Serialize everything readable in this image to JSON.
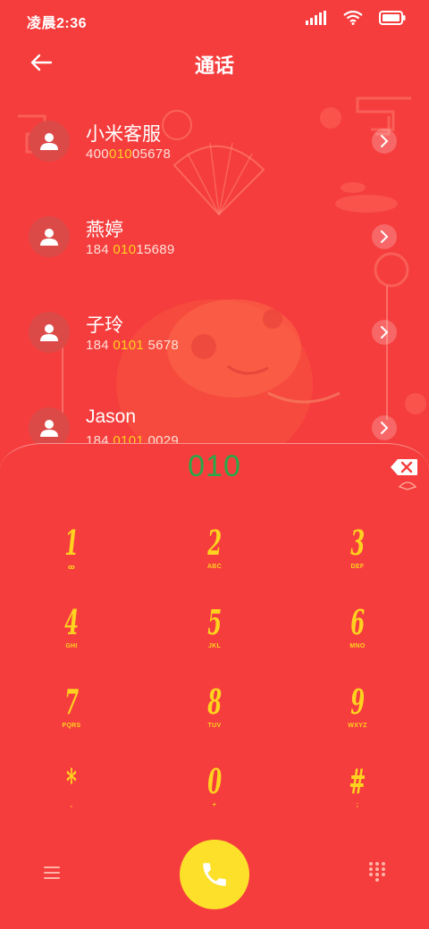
{
  "status_bar": {
    "time": "凌晨2:36",
    "icons": [
      "signal-icon",
      "wifi-icon",
      "battery-icon"
    ]
  },
  "header": {
    "title": "通话",
    "back_icon": "arrow-left-icon"
  },
  "contacts": [
    {
      "name": "小米客服",
      "number_pre": "400",
      "number_hl": "010",
      "number_post": "05678"
    },
    {
      "name": "燕婷",
      "number_pre": "184 ",
      "number_hl": "010",
      "number_post": "15689"
    },
    {
      "name": "子玲",
      "number_pre": "184 ",
      "number_hl": "0101",
      "number_post": " 5678"
    },
    {
      "name": "Jason",
      "number_pre": "184 ",
      "number_hl": "0101",
      "number_post": " 0029"
    }
  ],
  "dialpad": {
    "dialed": "010",
    "keys": [
      {
        "digit": "1",
        "letters": "ꝏ"
      },
      {
        "digit": "2",
        "letters": "ABC"
      },
      {
        "digit": "3",
        "letters": "DEF"
      },
      {
        "digit": "4",
        "letters": "GHI"
      },
      {
        "digit": "5",
        "letters": "JKL"
      },
      {
        "digit": "6",
        "letters": "MNO"
      },
      {
        "digit": "7",
        "letters": "PQRS"
      },
      {
        "digit": "8",
        "letters": "TUV"
      },
      {
        "digit": "9",
        "letters": "WXYZ"
      },
      {
        "digit": "*",
        "letters": ","
      },
      {
        "digit": "0",
        "letters": "+"
      },
      {
        "digit": "#",
        "letters": ";"
      }
    ]
  },
  "colors": {
    "background": "#f53d3d",
    "accent_yellow": "#ffd21f",
    "dialed_green": "#2aa84a",
    "call_button": "#fde02a"
  }
}
